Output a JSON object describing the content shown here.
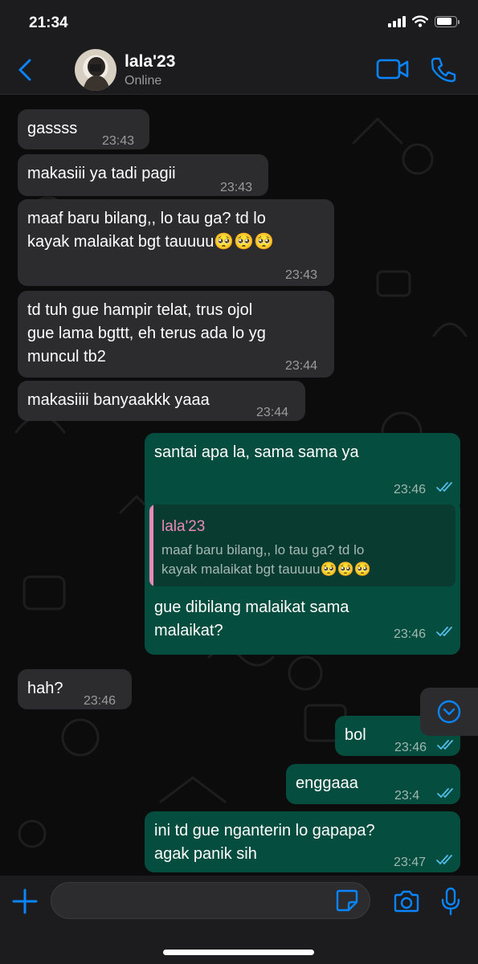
{
  "status_bar": {
    "time": "21:34"
  },
  "header": {
    "contact_name": "lala'23",
    "status": "Online"
  },
  "messages": [
    {
      "dir": "in",
      "text": "gassss",
      "time": "23:43"
    },
    {
      "dir": "in",
      "text": "makasiii ya tadi pagii",
      "time": "23:43"
    },
    {
      "dir": "in",
      "text": "maaf baru bilang,, lo tau ga? td lo\nkayak malaikat bgt tauuuu🥺🥺🥺",
      "time": "23:43"
    },
    {
      "dir": "in",
      "text": "td tuh gue hampir telat, trus ojol\ngue lama bgttt, eh terus ada lo yg\nmuncul tb2",
      "time": "23:44"
    },
    {
      "dir": "in",
      "text": "makasiiii banyaakkk yaaa",
      "time": "23:44"
    },
    {
      "dir": "out",
      "text": "santai apa la, sama sama ya",
      "time": "23:46"
    },
    {
      "dir": "out",
      "text": "gue dibilang malaikat sama\nmalaikat?",
      "time": "23:46",
      "quote": {
        "name": "lala'23",
        "text": "maaf baru bilang,, lo tau ga? td lo\nkayak malaikat bgt tauuuu🥺🥺🥺"
      }
    },
    {
      "dir": "in",
      "text": "hah?",
      "time": "23:46"
    },
    {
      "dir": "out",
      "text": "bol",
      "time": "23:46"
    },
    {
      "dir": "out",
      "text": "enggaaa",
      "time": "23:4"
    },
    {
      "dir": "out",
      "text": "ini td gue nganterin lo gapapa?\nagak panik sih",
      "time": "23:47"
    }
  ],
  "composer": {
    "placeholder": ""
  },
  "colors": {
    "accent": "#0a84ff",
    "incoming": "#2c2c2e",
    "outgoing": "#054d3e",
    "quote_name": "#e88ab9",
    "read_ticks": "#53bdeb"
  }
}
